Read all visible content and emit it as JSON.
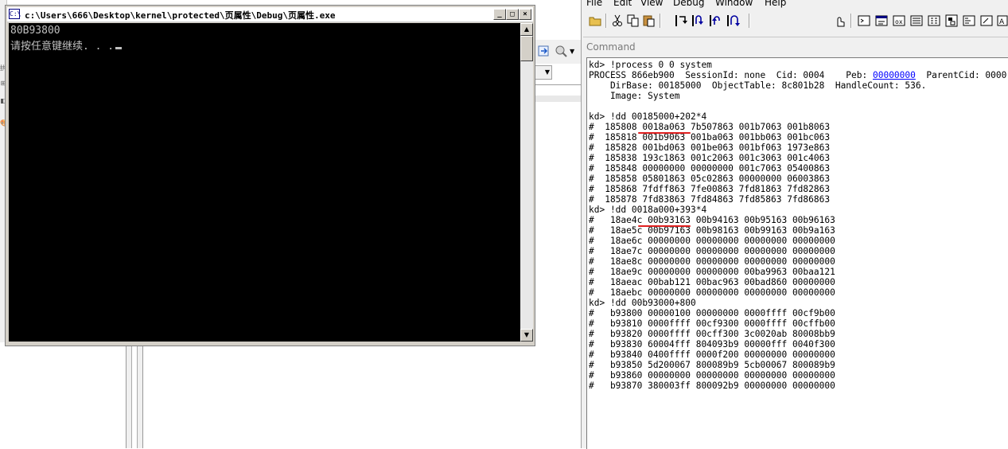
{
  "console": {
    "title": "c:\\Users\\666\\Desktop\\kernel\\protected\\页属性\\Debug\\页属性.exe",
    "icon_label": "C:\\",
    "buttons": {
      "minimize": "_",
      "maximize": "□",
      "close": "×"
    },
    "lines": [
      "80B93800",
      "请按任意键继续. . ."
    ]
  },
  "background_app": {
    "strip_glyphs": [
      "拱",
      "⊞",
      "◧",
      "🎨"
    ]
  },
  "debugger": {
    "menu": [
      "File",
      "Edit",
      "View",
      "Debug",
      "Window",
      "Help"
    ],
    "toolbar_icons": [
      "open-icon",
      "cut-icon",
      "copy-icon",
      "paste-icon",
      "step-into-icon",
      "step-over-icon",
      "step-out-icon",
      "run-to-cursor-icon",
      "source-mode-icon",
      "command-window-icon",
      "watch-window-icon",
      "locals-window-icon",
      "registers-window-icon",
      "memory-window-icon",
      "call-stack-icon",
      "disassembly-window-icon",
      "scratch-pad-icon",
      "font-icon",
      "options-icon"
    ],
    "command_header": "Command",
    "output": [
      {
        "text": "kd> !process 0 0 system"
      },
      {
        "prefix": "PROCESS 866eb900  SessionId: none  Cid: 0004    Peb: ",
        "link": "00000000",
        "suffix": "  ParentCid: 0000"
      },
      {
        "text": "    DirBase: 00185000  ObjectTable: 8c801b28  HandleCount: 536."
      },
      {
        "text": "    Image: System"
      },
      {
        "text": ""
      },
      {
        "text": "kd> !dd 00185000+202*4"
      },
      {
        "text": "#  185808 0018a063 7b507863 001b7063 001b8063"
      },
      {
        "text": "#  185818 001b9063 001ba063 001bb063 001bc063"
      },
      {
        "text": "#  185828 001bd063 001be063 001bf063 1973e863"
      },
      {
        "text": "#  185838 193c1863 001c2063 001c3063 001c4063"
      },
      {
        "text": "#  185848 00000000 00000000 001c7063 05400863"
      },
      {
        "text": "#  185858 05801863 05c02863 00000000 06003863"
      },
      {
        "text": "#  185868 7fdff863 7fe00863 7fd81863 7fd82863"
      },
      {
        "text": "#  185878 7fd83863 7fd84863 7fd85863 7fd86863"
      },
      {
        "text": "kd> !dd 0018a000+393*4"
      },
      {
        "text": "#   18ae4c 00b93163 00b94163 00b95163 00b96163"
      },
      {
        "text": "#   18ae5c 00b97163 00b98163 00b99163 00b9a163"
      },
      {
        "text": "#   18ae6c 00000000 00000000 00000000 00000000"
      },
      {
        "text": "#   18ae7c 00000000 00000000 00000000 00000000"
      },
      {
        "text": "#   18ae8c 00000000 00000000 00000000 00000000"
      },
      {
        "text": "#   18ae9c 00000000 00000000 00ba9963 00baa121"
      },
      {
        "text": "#   18aeac 00bab121 00bac963 00bad860 00000000"
      },
      {
        "text": "#   18aebc 00000000 00000000 00000000 00000000"
      },
      {
        "text": "kd> !dd 00b93000+800"
      },
      {
        "text": "#   b93800 00000100 00000000 0000ffff 00cf9b00"
      },
      {
        "text": "#   b93810 0000ffff 00cf9300 0000ffff 00cffb00"
      },
      {
        "text": "#   b93820 0000ffff 00cff300 3c0020ab 80008bb9"
      },
      {
        "text": "#   b93830 60004fff 804093b9 00000fff 0040f300"
      },
      {
        "text": "#   b93840 0400ffff 0000f200 00000000 00000000"
      },
      {
        "text": "#   b93850 5d200067 800089b9 5cb00067 800089b9"
      },
      {
        "text": "#   b93860 00000000 00000000 00000000 00000000"
      },
      {
        "text": "#   b93870 380003ff 800092b9 00000000 00000000"
      }
    ]
  }
}
